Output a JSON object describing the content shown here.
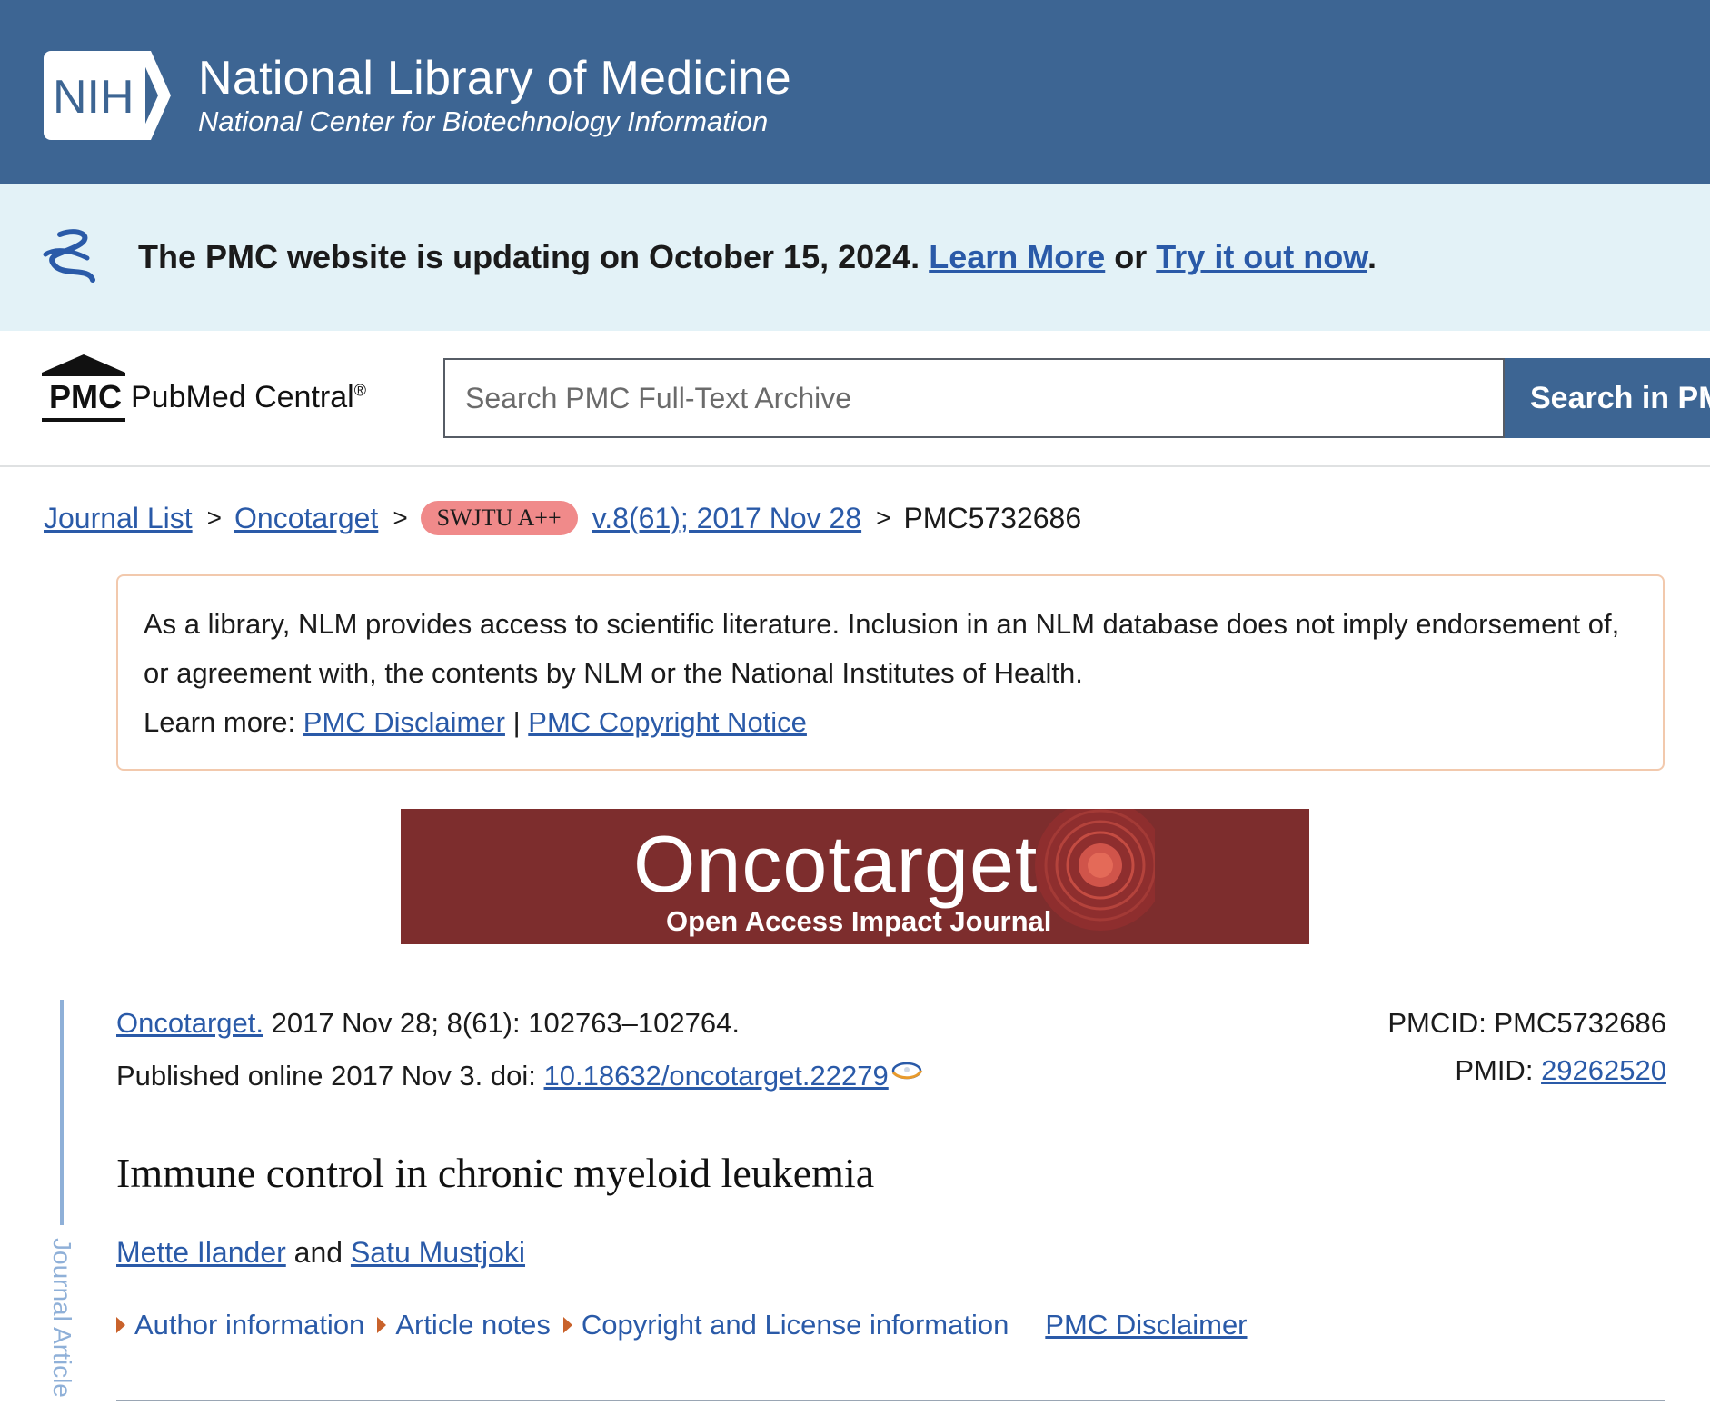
{
  "nih_header": {
    "logo_text": "NIH",
    "title": "National Library of Medicine",
    "subtitle": "National Center for Biotechnology Information"
  },
  "update_banner": {
    "text": "The PMC website is updating on October 15, 2024.",
    "learn_more": "Learn More",
    "or": "or",
    "try_it": "Try it out now",
    "period": "."
  },
  "pmc_header": {
    "abbr": "PMC",
    "name": "PubMed Central",
    "reg": "®",
    "search_placeholder": "Search PMC Full-Text Archive",
    "search_button": "Search in PMC"
  },
  "breadcrumb": {
    "items": [
      "Journal List",
      "Oncotarget"
    ],
    "separator": ">",
    "badge": "SWJTU A++",
    "issue": "v.8(61); 2017 Nov 28",
    "current": "PMC5732686"
  },
  "disclaimer": {
    "text": "As a library, NLM provides access to scientific literature. Inclusion in an NLM database does not imply endorsement of, or agreement with, the contents by NLM or the National Institutes of Health.",
    "learn_more": "Learn more:",
    "link1": "PMC Disclaimer",
    "divider": "|",
    "link2": "PMC Copyright Notice"
  },
  "journal_banner": {
    "name": "Oncotarget",
    "tagline": "Open Access Impact Journal"
  },
  "article": {
    "journal_link": "Oncotarget.",
    "citation": "2017 Nov 28; 8(61): 102763–102764.",
    "published": "Published online 2017 Nov 3. doi:",
    "doi": "10.18632/oncotarget.22279",
    "pmcid_label": "PMCID: PMC5732686",
    "pmid_label": "PMID:",
    "pmid": "29262520",
    "title": "Immune control in chronic myeloid leukemia",
    "authors": [
      "Mette Ilander",
      "Satu Mustjoki"
    ],
    "and": "and",
    "meta_links": [
      "Author information",
      "Article notes",
      "Copyright and License information"
    ],
    "disclaimer_link": "PMC Disclaimer",
    "side_label": "Journal Article"
  },
  "colors": {
    "nih_blue": "#3d6593",
    "banner_bg": "#e3f2f7",
    "link": "#2a5aa8",
    "badge": "#f08a8a",
    "journal_banner": "#7d2d2d"
  },
  "icons": [
    "nih-logo-icon",
    "helix-icon",
    "pmc-building-icon",
    "doi-icon",
    "triangle-right-icon",
    "target-icon"
  ]
}
